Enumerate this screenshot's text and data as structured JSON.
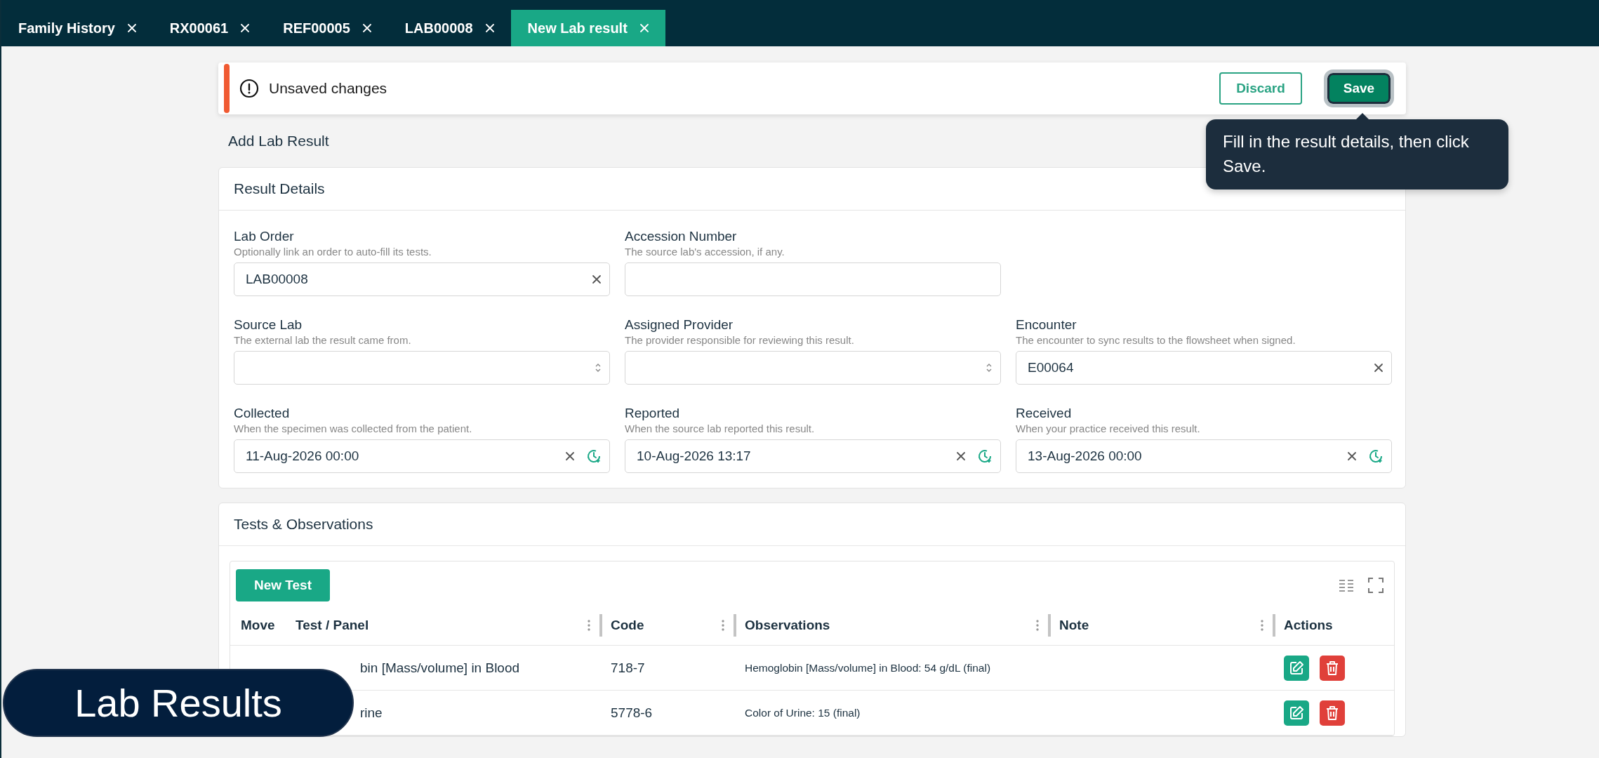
{
  "tabs": [
    {
      "label": "Family History",
      "selected": false
    },
    {
      "label": "RX00061",
      "selected": false
    },
    {
      "label": "REF00005",
      "selected": false
    },
    {
      "label": "LAB00008",
      "selected": false
    },
    {
      "label": "New Lab result",
      "selected": true
    }
  ],
  "unsaved_bar": {
    "message": "Unsaved changes",
    "discard": "Discard",
    "save": "Save"
  },
  "tooltip": "Fill in the result details, then click Save.",
  "page_title": "Add Lab Result",
  "result_details": {
    "title": "Result Details",
    "rows": [
      [
        {
          "label": "Lab Order",
          "hint": "Optionally link an order to auto-fill its tests.",
          "value": "LAB00008",
          "kind": "clearable"
        },
        {
          "label": "Accession Number",
          "hint": "The source lab's accession, if any.",
          "kind": "text"
        }
      ],
      [
        {
          "label": "Source Lab",
          "hint": "The external lab the result came from.",
          "kind": "select"
        },
        {
          "label": "Assigned Provider",
          "hint": "The provider responsible for reviewing this result.",
          "kind": "select"
        },
        {
          "label": "Encounter",
          "hint": "The encounter to sync results to the flowsheet when signed.",
          "value": "E00064",
          "kind": "clearable"
        }
      ],
      [
        {
          "label": "Collected",
          "hint": "When the specimen was collected from the patient.",
          "value": "11-Aug-2026 00:00",
          "kind": "datetime"
        },
        {
          "label": "Reported",
          "hint": "When the source lab reported this result.",
          "value": "10-Aug-2026 13:17",
          "kind": "datetime"
        },
        {
          "label": "Received",
          "hint": "When your practice received this result.",
          "value": "13-Aug-2026 00:00",
          "kind": "datetime"
        }
      ]
    ]
  },
  "tests": {
    "title": "Tests & Observations",
    "new_button": "New Test",
    "columns": [
      {
        "label": "Move",
        "menu": false
      },
      {
        "label": "Test / Panel",
        "menu": true
      },
      {
        "label": "Code",
        "menu": true
      },
      {
        "label": "Observations",
        "menu": true
      },
      {
        "label": "Note",
        "menu": true
      },
      {
        "label": "Actions",
        "menu": false
      }
    ],
    "rows": [
      {
        "test_panel": "bin [Mass/volume] in Blood",
        "code": "718-7",
        "observations": "Hemoglobin [Mass/volume] in Blood: 54 g/dL (final)"
      },
      {
        "test_panel": "rine",
        "code": "5778-6",
        "observations": "Color of Urine: 15 (final)"
      }
    ]
  },
  "caption": "Lab Results"
}
